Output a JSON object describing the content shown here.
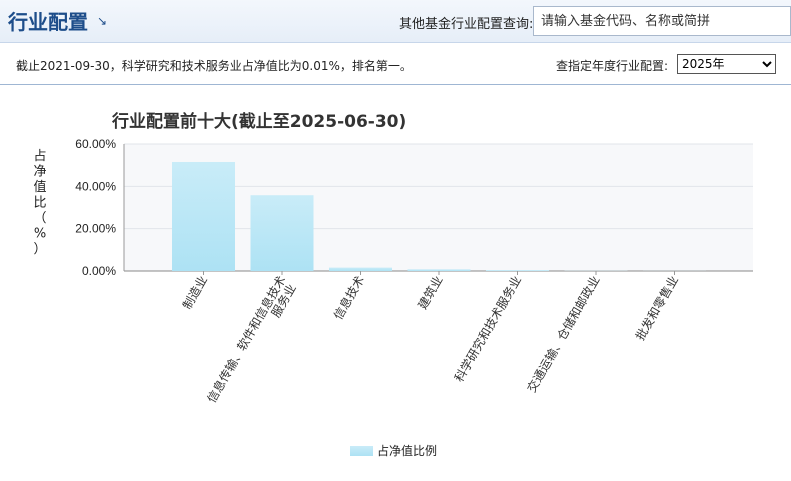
{
  "header": {
    "title": "行业配置",
    "title_arrow": "↘",
    "search_label": "其他基金行业配置查询:",
    "search_placeholder": "请输入基金代码、名称或简拼"
  },
  "info": {
    "summary": "截止2021-09-30，科学研究和技术服务业占净值比为0.01%，排名第一。",
    "year_label": "查指定年度行业配置:",
    "year_options": [
      "2025年"
    ],
    "year_selected": "2025年"
  },
  "colors": {
    "bar_top": "#c9ecf8",
    "bar_bottom": "#ade2f4",
    "title": "#333333",
    "plot_bg": "#f7f8fa"
  },
  "chart_data": {
    "type": "bar",
    "title": "行业配置前十大(截止至2025-06-30)",
    "ylabel_chars": [
      "占",
      "净",
      "值",
      "比",
      "（",
      "%",
      "）"
    ],
    "yticks": [
      "0.00%",
      "20.00%",
      "40.00%",
      "60.00%"
    ],
    "ylim": [
      0,
      60
    ],
    "categories": [
      "制造业",
      "信息传输、软件和信息技术服务业",
      "信息技术",
      "建筑业",
      "科学研究和技术服务业",
      "交通运输、仓储和邮政业",
      "批发和零售业"
    ],
    "values": [
      51.5,
      35.8,
      1.6,
      0.8,
      0.4,
      0.1,
      0.05
    ],
    "legend": "占净值比例",
    "grid": true
  }
}
